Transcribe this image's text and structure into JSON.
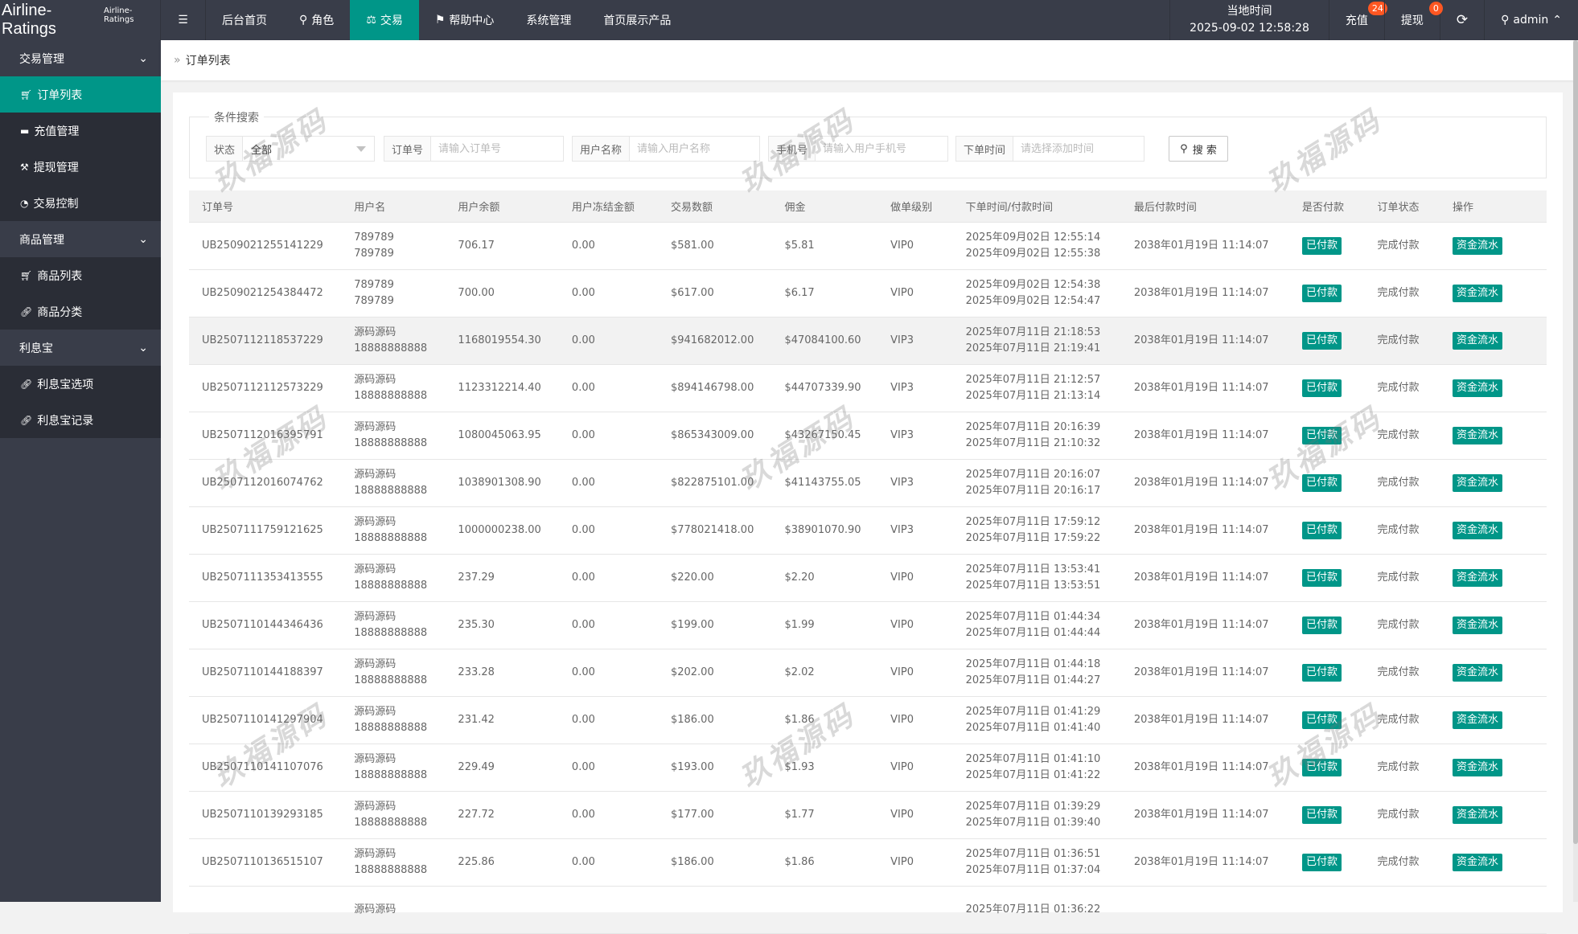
{
  "app": {
    "title": "Airline-Ratings",
    "subtitle": "Airline-Ratings"
  },
  "topnav": {
    "items": [
      {
        "label": "后台首页",
        "icon": ""
      },
      {
        "label": "角色",
        "icon": "user-icon"
      },
      {
        "label": "交易",
        "icon": "scale-icon",
        "active": true
      },
      {
        "label": "帮助中心",
        "icon": "flag-icon"
      },
      {
        "label": "系统管理",
        "icon": ""
      },
      {
        "label": "首页展示产品",
        "icon": ""
      }
    ],
    "clock_label": "当地时间",
    "clock_value": "2025-09-02 12:58:28",
    "recharge": "充值",
    "recharge_badge": "24",
    "withdraw": "提现",
    "withdraw_badge": "0",
    "user": "admin"
  },
  "sidebar": {
    "groups": [
      {
        "label": "交易管理",
        "items": [
          {
            "label": "订单列表",
            "icon": "cart-icon",
            "active": true
          },
          {
            "label": "充值管理",
            "icon": "card-icon"
          },
          {
            "label": "提现管理",
            "icon": "hammer-icon"
          },
          {
            "label": "交易控制",
            "icon": "gauge-icon"
          }
        ]
      },
      {
        "label": "商品管理",
        "items": [
          {
            "label": "商品列表",
            "icon": "cart-icon"
          },
          {
            "label": "商品分类",
            "icon": "link-icon"
          }
        ]
      },
      {
        "label": "利息宝",
        "items": [
          {
            "label": "利息宝选项",
            "icon": "link-icon"
          },
          {
            "label": "利息宝记录",
            "icon": "link-icon"
          }
        ]
      }
    ]
  },
  "breadcrumb": "订单列表",
  "search": {
    "legend": "条件搜索",
    "status_label": "状态",
    "status_value": "全部",
    "order_label": "订单号",
    "order_placeholder": "请输入订单号",
    "user_label": "用户名称",
    "user_placeholder": "请输入用户名称",
    "phone_label": "手机号",
    "phone_placeholder": "请输入用户手机号",
    "time_label": "下单时间",
    "time_placeholder": "请选择添加时间",
    "button": "搜 索"
  },
  "watermark": "玖福源码",
  "colors": {
    "accent": "#009688",
    "topbar": "#393d49",
    "badge": "#ff5722"
  },
  "table": {
    "headers": [
      "订单号",
      "用户名",
      "用户余额",
      "用户冻结金额",
      "交易数额",
      "佣金",
      "做单级别",
      "下单时间/付款时间",
      "最后付款时间",
      "是否付款",
      "订单状态",
      "操作"
    ],
    "rows": [
      [
        "UB2509021255141229",
        "789789",
        "789789",
        "706.17",
        "0.00",
        "$581.00",
        "$5.81",
        "VIP0",
        "2025年09月02日 12:55:14",
        "2025年09月02日 12:55:38",
        "2038年01月19日 11:14:07",
        "已付款",
        "完成付款",
        "资金流水"
      ],
      [
        "UB2509021254384472",
        "789789",
        "789789",
        "700.00",
        "0.00",
        "$617.00",
        "$6.17",
        "VIP0",
        "2025年09月02日 12:54:38",
        "2025年09月02日 12:54:47",
        "2038年01月19日 11:14:07",
        "已付款",
        "完成付款",
        "资金流水"
      ],
      [
        "UB2507112118537229",
        "源码源码",
        "18888888888",
        "1168019554.30",
        "0.00",
        "$941682012.00",
        "$47084100.60",
        "VIP3",
        "2025年07月11日 21:18:53",
        "2025年07月11日 21:19:41",
        "2038年01月19日 11:14:07",
        "已付款",
        "完成付款",
        "资金流水"
      ],
      [
        "UB2507112112573229",
        "源码源码",
        "18888888888",
        "1123312214.40",
        "0.00",
        "$894146798.00",
        "$44707339.90",
        "VIP3",
        "2025年07月11日 21:12:57",
        "2025年07月11日 21:13:14",
        "2038年01月19日 11:14:07",
        "已付款",
        "完成付款",
        "资金流水"
      ],
      [
        "UB2507112016395791",
        "源码源码",
        "18888888888",
        "1080045063.95",
        "0.00",
        "$865343009.00",
        "$43267150.45",
        "VIP3",
        "2025年07月11日 20:16:39",
        "2025年07月11日 21:10:32",
        "2038年01月19日 11:14:07",
        "已付款",
        "完成付款",
        "资金流水"
      ],
      [
        "UB2507112016074762",
        "源码源码",
        "18888888888",
        "1038901308.90",
        "0.00",
        "$822875101.00",
        "$41143755.05",
        "VIP3",
        "2025年07月11日 20:16:07",
        "2025年07月11日 20:16:17",
        "2038年01月19日 11:14:07",
        "已付款",
        "完成付款",
        "资金流水"
      ],
      [
        "UB2507111759121625",
        "源码源码",
        "18888888888",
        "1000000238.00",
        "0.00",
        "$778021418.00",
        "$38901070.90",
        "VIP3",
        "2025年07月11日 17:59:12",
        "2025年07月11日 17:59:22",
        "2038年01月19日 11:14:07",
        "已付款",
        "完成付款",
        "资金流水"
      ],
      [
        "UB2507111353413555",
        "源码源码",
        "18888888888",
        "237.29",
        "0.00",
        "$220.00",
        "$2.20",
        "VIP0",
        "2025年07月11日 13:53:41",
        "2025年07月11日 13:53:51",
        "2038年01月19日 11:14:07",
        "已付款",
        "完成付款",
        "资金流水"
      ],
      [
        "UB2507110144346436",
        "源码源码",
        "18888888888",
        "235.30",
        "0.00",
        "$199.00",
        "$1.99",
        "VIP0",
        "2025年07月11日 01:44:34",
        "2025年07月11日 01:44:44",
        "2038年01月19日 11:14:07",
        "已付款",
        "完成付款",
        "资金流水"
      ],
      [
        "UB2507110144188397",
        "源码源码",
        "18888888888",
        "233.28",
        "0.00",
        "$202.00",
        "$2.02",
        "VIP0",
        "2025年07月11日 01:44:18",
        "2025年07月11日 01:44:27",
        "2038年01月19日 11:14:07",
        "已付款",
        "完成付款",
        "资金流水"
      ],
      [
        "UB2507110141297904",
        "源码源码",
        "18888888888",
        "231.42",
        "0.00",
        "$186.00",
        "$1.86",
        "VIP0",
        "2025年07月11日 01:41:29",
        "2025年07月11日 01:41:40",
        "2038年01月19日 11:14:07",
        "已付款",
        "完成付款",
        "资金流水"
      ],
      [
        "UB2507110141107076",
        "源码源码",
        "18888888888",
        "229.49",
        "0.00",
        "$193.00",
        "$1.93",
        "VIP0",
        "2025年07月11日 01:41:10",
        "2025年07月11日 01:41:22",
        "2038年01月19日 11:14:07",
        "已付款",
        "完成付款",
        "资金流水"
      ],
      [
        "UB2507110139293185",
        "源码源码",
        "18888888888",
        "227.72",
        "0.00",
        "$177.00",
        "$1.77",
        "VIP0",
        "2025年07月11日 01:39:29",
        "2025年07月11日 01:39:40",
        "2038年01月19日 11:14:07",
        "已付款",
        "完成付款",
        "资金流水"
      ],
      [
        "UB2507110136515107",
        "源码源码",
        "18888888888",
        "225.86",
        "0.00",
        "$186.00",
        "$1.86",
        "VIP0",
        "2025年07月11日 01:36:51",
        "2025年07月11日 01:37:04",
        "2038年01月19日 11:14:07",
        "已付款",
        "完成付款",
        "资金流水"
      ],
      [
        "",
        "源码源码",
        "",
        "",
        "",
        "",
        "",
        "",
        "2025年07月11日 01:36:22",
        "",
        "",
        "",
        "",
        ""
      ]
    ]
  }
}
